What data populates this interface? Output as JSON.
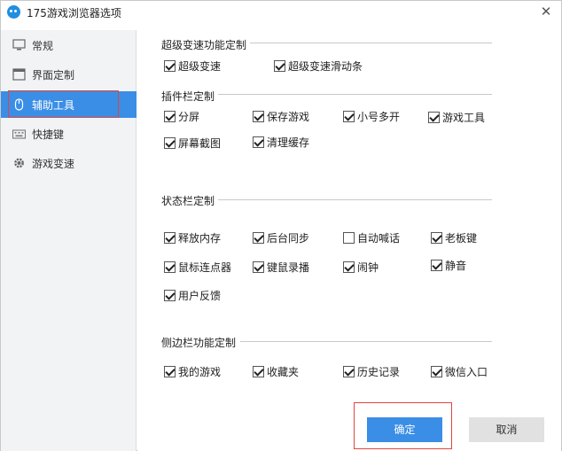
{
  "window": {
    "title": "175游戏浏览器选项",
    "close_label": "✕"
  },
  "sidebar": {
    "items": [
      {
        "label": "常规",
        "icon": "monitor-icon"
      },
      {
        "label": "界面定制",
        "icon": "window-layout-icon"
      },
      {
        "label": "辅助工具",
        "icon": "mouse-icon",
        "active": true
      },
      {
        "label": "快捷键",
        "icon": "keyboard-icon"
      },
      {
        "label": "游戏变速",
        "icon": "gear-icon"
      }
    ]
  },
  "sections": {
    "speed": {
      "title": "超级变速功能定制",
      "options": [
        {
          "label": "超级变速",
          "checked": true
        },
        {
          "label": "超级变速滑动条",
          "checked": true
        }
      ]
    },
    "plugin_bar": {
      "title": "插件栏定制",
      "options": [
        {
          "label": "分屏",
          "checked": true
        },
        {
          "label": "保存游戏",
          "checked": true
        },
        {
          "label": "小号多开",
          "checked": true
        },
        {
          "label": "游戏工具",
          "checked": true
        },
        {
          "label": "屏幕截图",
          "checked": true
        },
        {
          "label": "清理缓存",
          "checked": true
        }
      ]
    },
    "status_bar": {
      "title": "状态栏定制",
      "options": [
        {
          "label": "释放内存",
          "checked": true
        },
        {
          "label": "后台同步",
          "checked": true
        },
        {
          "label": "自动喊话",
          "checked": false
        },
        {
          "label": "老板键",
          "checked": true
        },
        {
          "label": "鼠标连点器",
          "checked": true
        },
        {
          "label": "键鼠录播",
          "checked": true
        },
        {
          "label": "闹钟",
          "checked": true
        },
        {
          "label": "静音",
          "checked": true
        },
        {
          "label": "用户反馈",
          "checked": true
        }
      ]
    },
    "side_bar": {
      "title": "侧边栏功能定制",
      "options": [
        {
          "label": "我的游戏",
          "checked": true
        },
        {
          "label": "收藏夹",
          "checked": true
        },
        {
          "label": "历史记录",
          "checked": true
        },
        {
          "label": "微信入口",
          "checked": true
        }
      ]
    }
  },
  "buttons": {
    "ok": "确定",
    "cancel": "取消"
  },
  "colors": {
    "accent": "#3a8ee6",
    "highlight_border": "#e0463f",
    "sidebar_bg": "#f2f3f5"
  }
}
